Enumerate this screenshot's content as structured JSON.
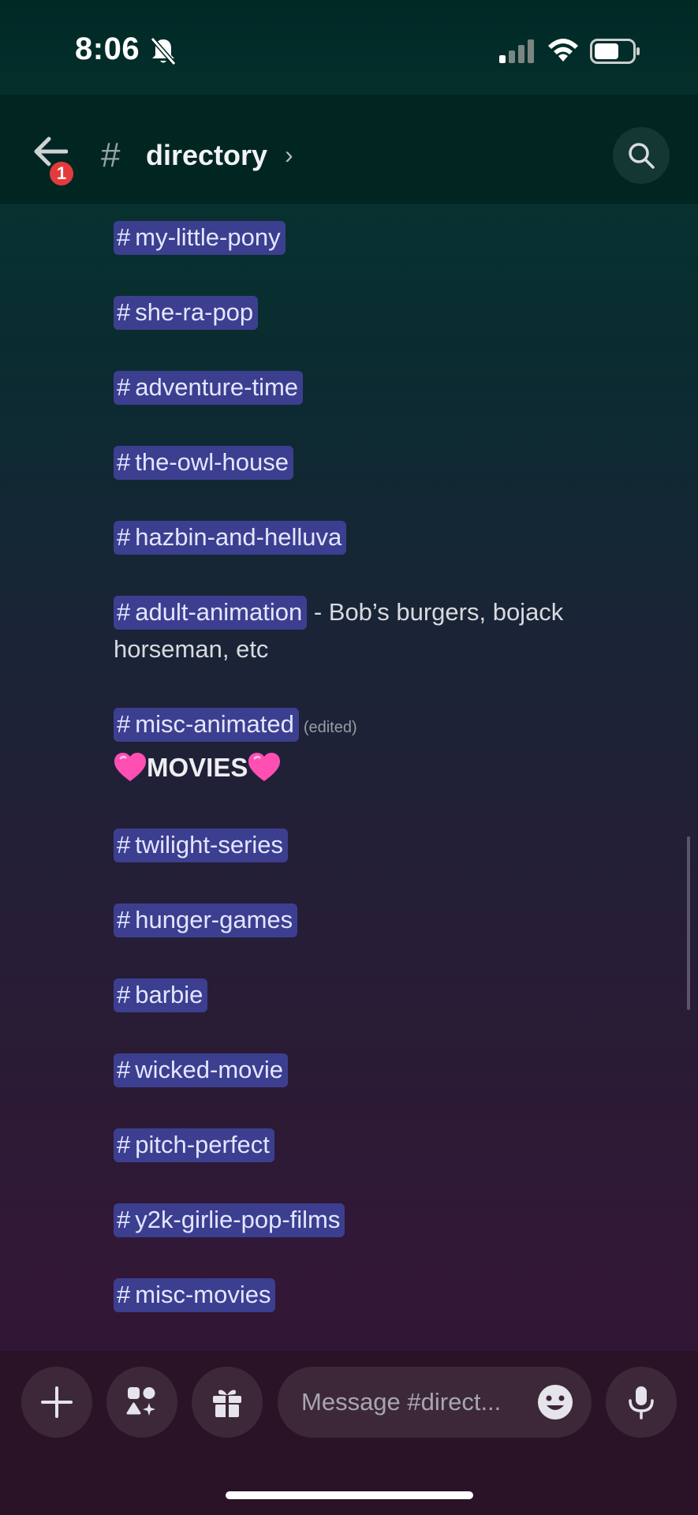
{
  "status_bar": {
    "time": "8:06"
  },
  "header": {
    "back_badge": "1",
    "hash": "#",
    "title": "directory",
    "chevron": "›"
  },
  "messages": [
    {
      "channel": "my-little-pony"
    },
    {
      "channel": "she-ra-pop"
    },
    {
      "channel": "adventure-time"
    },
    {
      "channel": "the-owl-house"
    },
    {
      "channel": "hazbin-and-helluva"
    },
    {
      "channel": "adult-animation",
      "description_line1": " - Bob’s burgers, bojack",
      "description_line2": "horseman, etc"
    },
    {
      "channel": "misc-animated",
      "edited": "(edited)"
    },
    {
      "channel": "twilight-series"
    },
    {
      "channel": "hunger-games"
    },
    {
      "channel": "barbie"
    },
    {
      "channel": "wicked-movie"
    },
    {
      "channel": "pitch-perfect"
    },
    {
      "channel": "y2k-girlie-pop-films"
    },
    {
      "channel": "misc-movies"
    }
  ],
  "section": {
    "heading": "MOVIES",
    "emoji": "pink-heart"
  },
  "input_bar": {
    "placeholder": "Message #direct..."
  },
  "icons": {
    "back": "arrow-left-icon",
    "search": "search-icon",
    "add": "plus-icon",
    "apps": "apps-icon",
    "gift": "gift-icon",
    "emoji": "smiley-icon",
    "mic": "microphone-icon"
  },
  "colors": {
    "mention_bg": "#3c3f8f",
    "mention_text": "#e3e6ff",
    "badge": "#e33b3b"
  }
}
